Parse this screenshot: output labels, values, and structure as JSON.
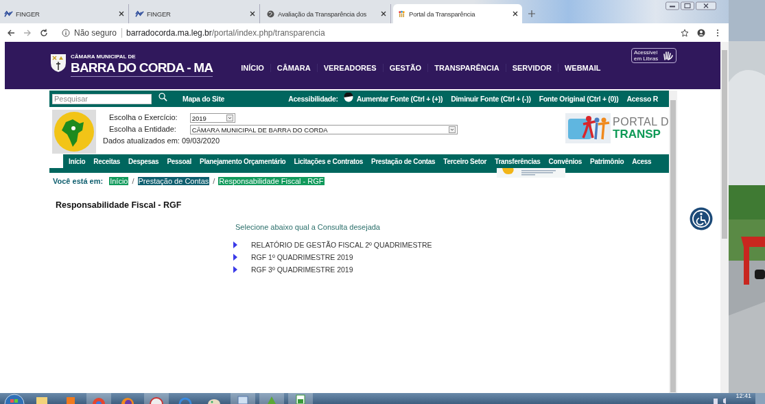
{
  "browser": {
    "tabs": [
      {
        "title": "FINGER",
        "kind": "finger",
        "selected": false
      },
      {
        "title": "FINGER",
        "kind": "finger",
        "selected": false
      },
      {
        "title": "Avaliação da Transparência dos",
        "kind": "web",
        "selected": false
      },
      {
        "title": "Portal da Transparência",
        "kind": "portal",
        "selected": true
      }
    ],
    "security": "Não seguro",
    "url": "**barradocorda.ma.leg.br**/portal/index.php/transparencia"
  },
  "header": {
    "logo_small": "CÂMARA MUNICIPAL DE",
    "logo_big": "BARRA DO CORDA - MA",
    "nav": [
      "INÍCIO",
      "CÂMARA",
      "VEREADORES",
      "GESTÃO",
      "TRANSPARÊNCIA",
      "SERVIDOR",
      "WEBMAIL"
    ],
    "libras": "Acessível em Libras"
  },
  "toolbar": {
    "search": {
      "placeholder": "Pesquisar"
    },
    "site_map": "Mapa do Site",
    "accessibility_label": "Acessibilidade:",
    "links": [
      "Aumentar Fonte (Ctrl + (+))",
      "Diminuir Fonte (Ctrl + (-))",
      "Fonte Original (Ctrl + (0))",
      "Acesso R"
    ]
  },
  "filters": {
    "year_label": "Escolha o Exercício:",
    "year": "2019",
    "entity_label": "Escolha a Entidade:",
    "entity": "CÂMARA MUNICIPAL DE BARRA DO CORDA",
    "updated": "Dados atualizados em: 09/03/2020",
    "portal_top": "PORTAL D",
    "portal_bottom": "TRANSP"
  },
  "menu": [
    "Início",
    "Receitas",
    "Despesas",
    "Pessoal",
    "Planejamento Orçamentário",
    "Licitações e Contratos",
    "Prestação de Contas",
    "Terceiro Setor",
    "Transferências",
    "Convênios",
    "Patrimônio",
    "Acess"
  ],
  "breadcrumb": {
    "label": "Você está em:",
    "separator": "/",
    "items": [
      {
        "text": "Início",
        "color": "#119a5c"
      },
      {
        "text": "Prestação de Contas",
        "color": "#0e5e6e"
      },
      {
        "text": "Responsabilidade Fiscal - RGF",
        "color": "#119a5c"
      }
    ]
  },
  "title": "Responsabilidade Fiscal - RGF",
  "prompt": "Selecione abaixo qual a Consulta desejada",
  "reports": [
    "RELATÓRIO DE GESTÃO FISCAL 2º QUADRIMESTRE",
    "RGF 1º QUADRIMESTRE 2019",
    "RGF 3º QUADRIMESTRE 2019"
  ],
  "taskbar": {
    "time": "12:41"
  }
}
